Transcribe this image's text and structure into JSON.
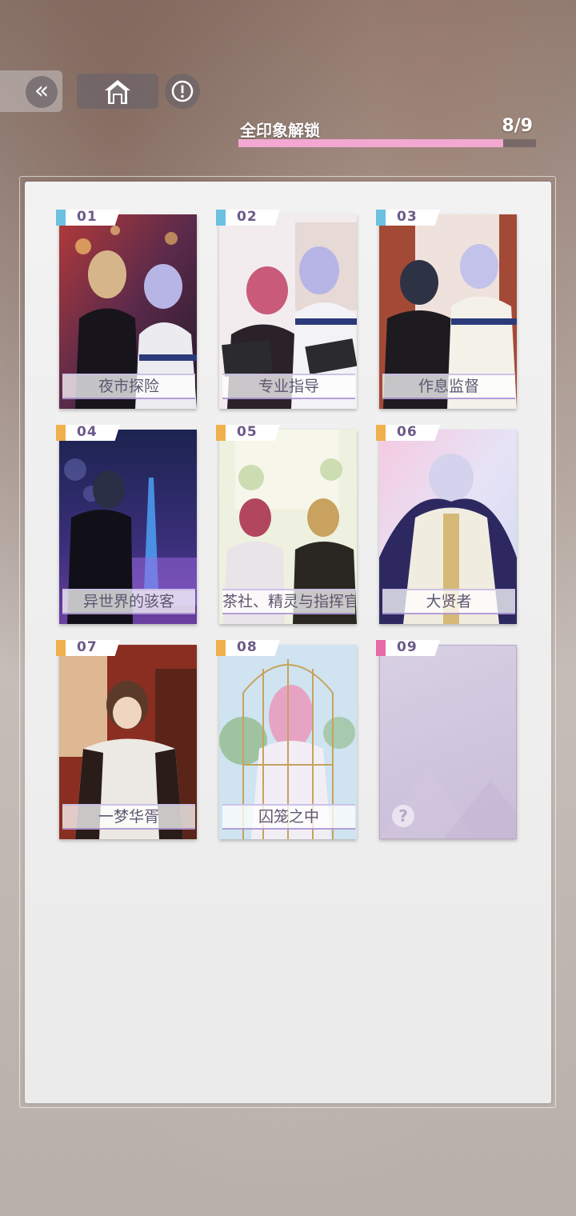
{
  "nav": {
    "back_glyph": "«",
    "home_icon": "home-icon",
    "info_icon": "info-icon"
  },
  "progress": {
    "label": "全印象解锁",
    "count": "8/9",
    "unlocked": 8,
    "total": 9,
    "fill_color": "#f2a8d2"
  },
  "cards": [
    {
      "num": "01",
      "title": "夜市探险",
      "flag": "#6cc1e3",
      "locked": false
    },
    {
      "num": "02",
      "title": "专业指导",
      "flag": "#6cc1e3",
      "locked": false
    },
    {
      "num": "03",
      "title": "作息监督",
      "flag": "#6cc1e3",
      "locked": false
    },
    {
      "num": "04",
      "title": "异世界的骇客",
      "flag": "#f0b04c",
      "locked": false
    },
    {
      "num": "05",
      "title": "茶社、精灵与指挥官",
      "flag": "#f0b04c",
      "locked": false
    },
    {
      "num": "06",
      "title": "大贤者",
      "flag": "#f0b04c",
      "locked": false
    },
    {
      "num": "07",
      "title": "一梦华胥",
      "flag": "#f0b04c",
      "locked": false
    },
    {
      "num": "08",
      "title": "囚笼之中",
      "flag": "#f0b04c",
      "locked": false
    },
    {
      "num": "09",
      "title": "",
      "flag": "#e86aa6",
      "locked": true,
      "locked_glyph": "?"
    }
  ]
}
